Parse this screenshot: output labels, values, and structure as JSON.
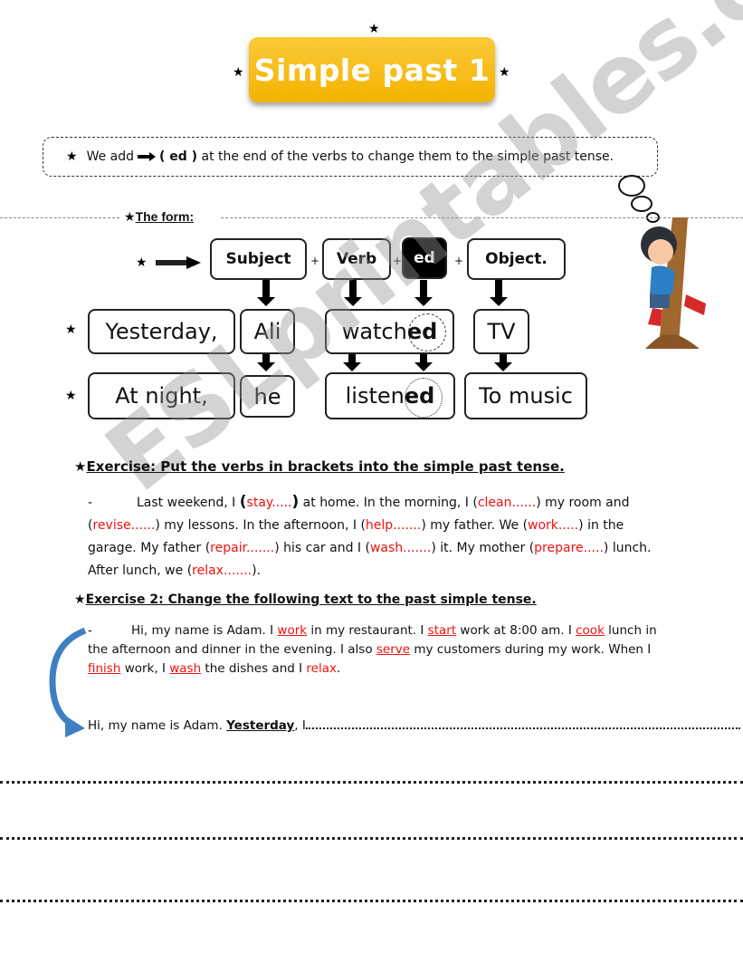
{
  "title": "Simple past 1",
  "rule": {
    "before": "We add",
    "ed": "( ed )",
    "after": "at the end of the verbs to change them to the simple past tense."
  },
  "form": {
    "label": "The form:",
    "headers": [
      "Subject",
      "Verb",
      "ed",
      "Object."
    ],
    "plus": "+",
    "row1": {
      "time": "Yesterday,",
      "subject": "Ali",
      "verb_stem": "watch",
      "verb_ed": "ed",
      "object": "TV"
    },
    "row2": {
      "time": "At night,",
      "subject": "he",
      "verb_stem": "listen",
      "verb_ed": "ed",
      "object": "To music"
    }
  },
  "exercise1": {
    "title": "Exercise: Put the verbs in brackets into the simple past tense.",
    "dash": "-",
    "segments": [
      {
        "t": "Last weekend, I "
      },
      {
        "t": "(",
        "b": true
      },
      {
        "t": "stay.....",
        "r": true
      },
      {
        "t": ")",
        "b": true
      },
      {
        "t": " at home. In the morning, I ("
      },
      {
        "t": "clean......",
        "r": true
      },
      {
        "t": ") my room and ("
      },
      {
        "t": "revise......",
        "r": true
      },
      {
        "t": ") my lessons. In the afternoon, I ("
      },
      {
        "t": "help.......",
        "r": true
      },
      {
        "t": ") my father. We ("
      },
      {
        "t": "work.....",
        "r": true
      },
      {
        "t": ") in the garage. My father ("
      },
      {
        "t": "repair.......",
        "r": true
      },
      {
        "t": ") his car and I ("
      },
      {
        "t": "wash.......",
        "r": true
      },
      {
        "t": ") it. My mother ("
      },
      {
        "t": "prepare.....",
        "r": true
      },
      {
        "t": ") lunch. After lunch, we ("
      },
      {
        "t": "relax.......",
        "r": true
      },
      {
        "t": ")."
      }
    ]
  },
  "exercise2": {
    "title": "Exercise 2: Change the following text to the past simple tense.",
    "dash": "-",
    "segments": [
      {
        "t": "Hi, my name is Adam. I "
      },
      {
        "t": "work",
        "u": true
      },
      {
        "t": " in my restaurant. I "
      },
      {
        "t": "start",
        "u": true
      },
      {
        "t": " work at 8:00 am. I "
      },
      {
        "t": "cook",
        "u": true
      },
      {
        "t": " lunch in the afternoon and dinner in the evening. I also "
      },
      {
        "t": "serve",
        "u": true
      },
      {
        "t": " my customers during my work. When I "
      },
      {
        "t": "finish",
        "u": true
      },
      {
        "t": " work, I "
      },
      {
        "t": "wash",
        "u": true
      },
      {
        "t": " the dishes and I "
      },
      {
        "t": "relax",
        "r": true
      },
      {
        "t": "."
      }
    ],
    "answer_start": "Hi, my name is Adam. ",
    "answer_bold": "Yesterday",
    "answer_rest": ", I"
  },
  "watermark": "ESLprintables.com",
  "colors": {
    "title_bg": "#f5b800",
    "verb_red": "#e11111",
    "arrow_blue": "#3f7fc4"
  }
}
